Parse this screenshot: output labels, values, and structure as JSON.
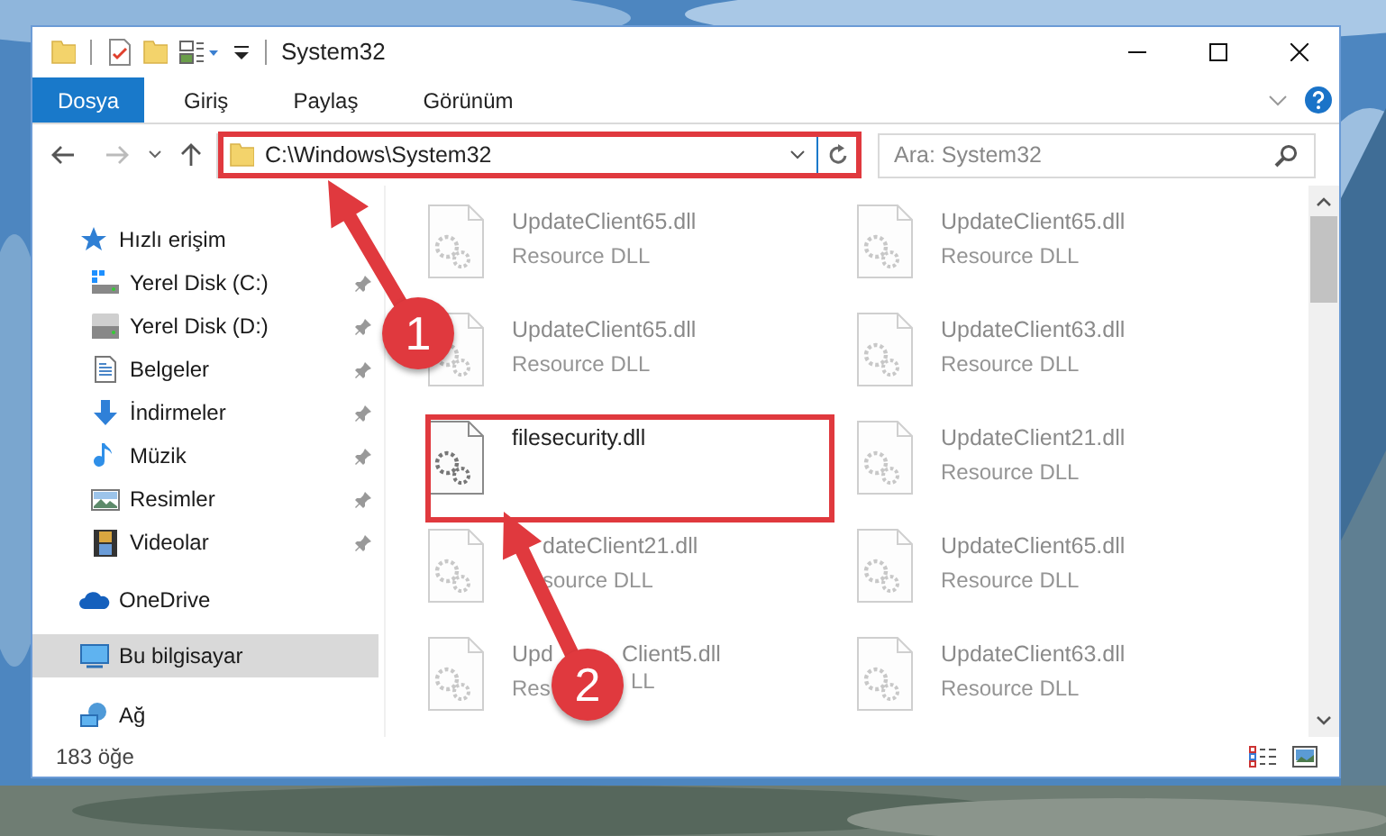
{
  "window": {
    "title": "System32"
  },
  "ribbon_tabs": [
    {
      "label": "Dosya",
      "selected": true
    },
    {
      "label": "Giriş",
      "selected": false
    },
    {
      "label": "Paylaş",
      "selected": false
    },
    {
      "label": "Görünüm",
      "selected": false
    }
  ],
  "address_bar": {
    "path": "C:\\Windows\\System32"
  },
  "search": {
    "placeholder": "Ara: System32"
  },
  "sidebar": {
    "items": [
      {
        "label": "Hızlı erişim",
        "selected": false,
        "children": [
          {
            "label": "Yerel Disk (C:)",
            "pinned": true,
            "selected": false
          },
          {
            "label": "Yerel Disk (D:)",
            "pinned": true,
            "selected": false
          },
          {
            "label": "Belgeler",
            "pinned": true,
            "selected": false
          },
          {
            "label": "İndirmeler",
            "pinned": true,
            "selected": false
          },
          {
            "label": "Müzik",
            "pinned": true,
            "selected": false
          },
          {
            "label": "Resimler",
            "pinned": true,
            "selected": false
          },
          {
            "label": "Videolar",
            "pinned": true,
            "selected": false
          }
        ]
      },
      {
        "label": "OneDrive",
        "selected": false
      },
      {
        "label": "Bu bilgisayar",
        "selected": true
      },
      {
        "label": "Ağ",
        "selected": false
      }
    ]
  },
  "files": [
    {
      "name": "UpdateClient65.dll",
      "type": "Resource DLL",
      "blurred": true
    },
    {
      "name": "UpdateClient65.dll",
      "type": "Resource DLL",
      "blurred": true
    },
    {
      "name": "UpdateClient65.dll",
      "type": "Resource DLL",
      "blurred": true
    },
    {
      "name": "UpdateClient63.dll",
      "type": "Resource DLL",
      "blurred": true
    },
    {
      "name": "filesecurity.dll",
      "blurred": false
    },
    {
      "name": "UpdateClient21.dll",
      "type": "Resource DLL",
      "blurred": true
    },
    {
      "kind": "covered_left",
      "name": "dateClient21.dll",
      "type": "source DLL",
      "blurred": true
    },
    {
      "name": "UpdateClient65.dll",
      "type": "Resource DLL",
      "blurred": true
    },
    {
      "kind": "covered_middle",
      "name": "Upd",
      "name_rest": "Client5.dll",
      "type": "Res",
      "type_rest": "LL",
      "blurred": true
    },
    {
      "name": "UpdateClient63.dll",
      "type": "Resource DLL",
      "blurred": true
    }
  ],
  "status_bar": {
    "item_count": "183 öğe"
  },
  "annotations": [
    {
      "number": "1"
    },
    {
      "number": "2"
    }
  ]
}
